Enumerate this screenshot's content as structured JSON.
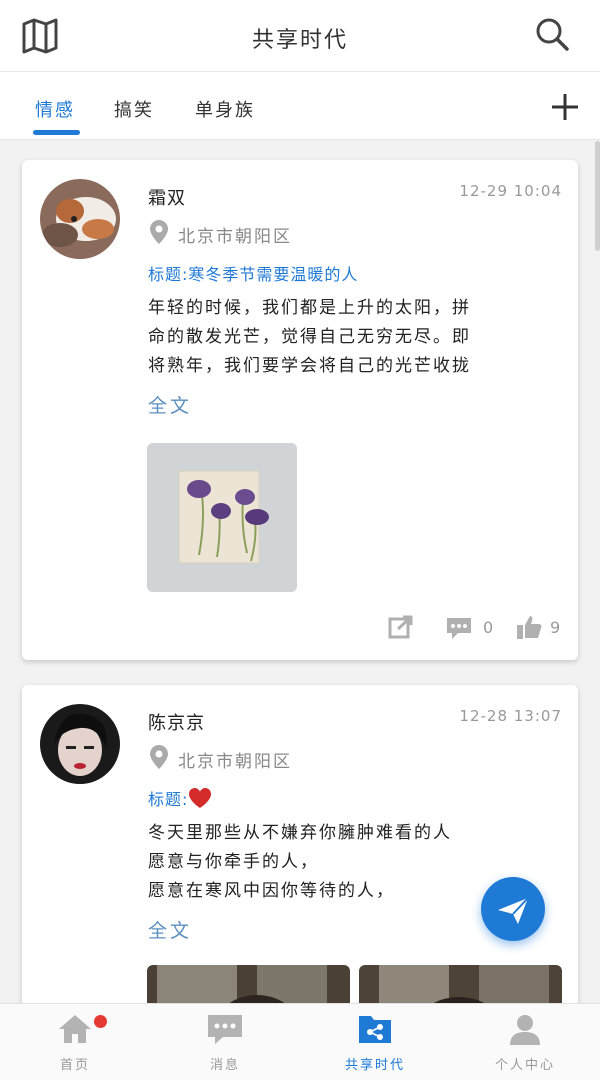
{
  "header": {
    "title": "共享时代",
    "map_icon": "map-icon",
    "search_icon": "search-icon"
  },
  "tabs": [
    {
      "label": "情感",
      "active": true
    },
    {
      "label": "搞笑",
      "active": false
    },
    {
      "label": "单身族",
      "active": false
    }
  ],
  "add_icon": "plus-icon",
  "posts": [
    {
      "author": "霜双",
      "time": "12-29  10:04",
      "location": "北京市朝阳区",
      "title": "标题:寒冬季节需要温暖的人",
      "lines": [
        "年轻的时候，我们都是上升的太阳，拼",
        "命的散发光芒，觉得自己无穷无尽。即",
        "将熟年，我们要学会将自己的光芒收拢"
      ],
      "full_text_label": "全文",
      "share_icon": "share-icon",
      "comment_count": "0",
      "like_count": "9"
    },
    {
      "author": "陈京京",
      "time": "12-28  13:07",
      "location": "北京市朝阳区",
      "title": "标题:",
      "title_emoji": "❤️",
      "lines": [
        "冬天里那些从不嫌弃你臃肿难看的人",
        "愿意与你牵手的人，",
        "愿意在寒风中因你等待的人，"
      ],
      "full_text_label": "全文"
    }
  ],
  "bottom_nav": [
    {
      "label": "首页",
      "icon": "home-icon",
      "active": false,
      "badge": true
    },
    {
      "label": "消息",
      "icon": "message-icon",
      "active": false,
      "badge": false
    },
    {
      "label": "共享时代",
      "icon": "share-folder-icon",
      "active": true,
      "badge": false
    },
    {
      "label": "个人中心",
      "icon": "person-icon",
      "active": false,
      "badge": false
    }
  ],
  "colors": {
    "accent": "#1f7ad6",
    "badge": "#e53935"
  }
}
